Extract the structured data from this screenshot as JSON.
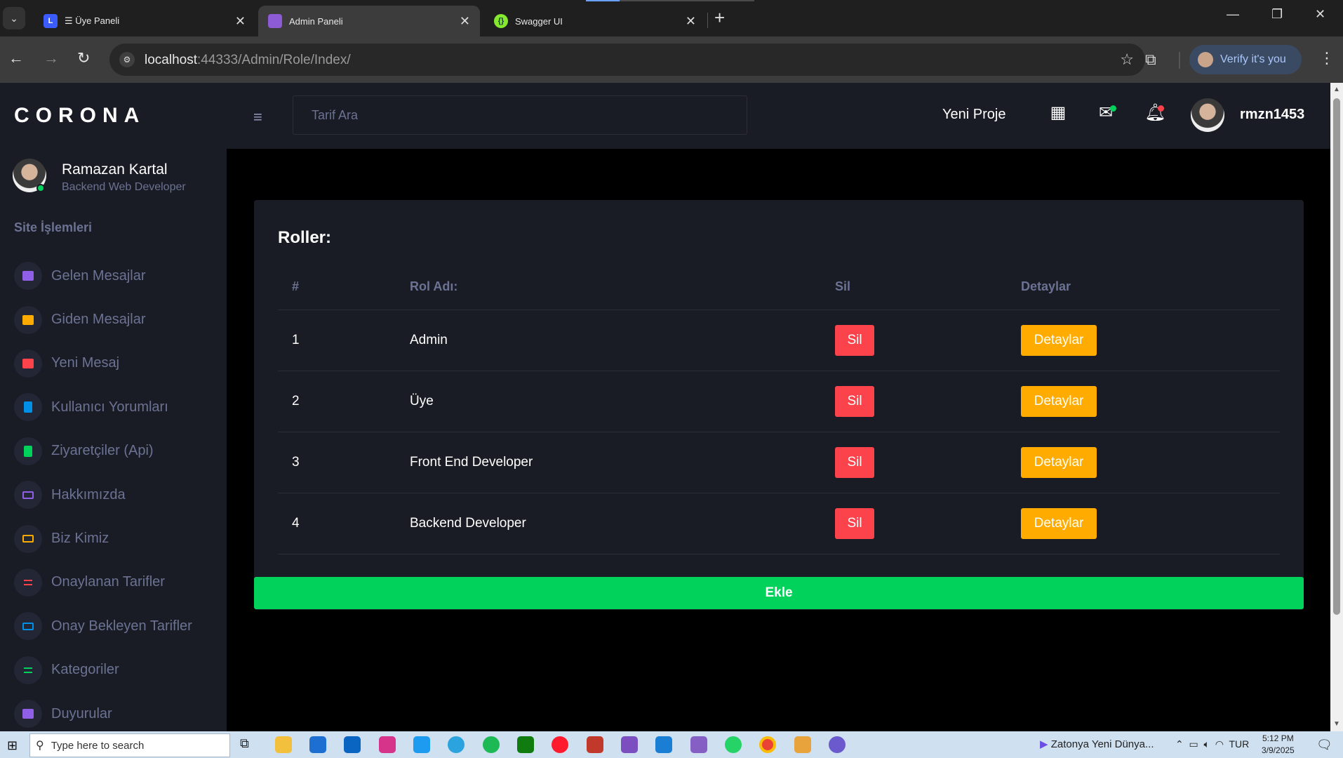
{
  "browser": {
    "tabs": [
      {
        "title": "☰ Üye Paneli",
        "favicon": "layout-icon",
        "color": "#3b5bfd",
        "active": false
      },
      {
        "title": "Admin Paneli",
        "favicon": "app-icon",
        "color": "#8e5bd6",
        "active": true
      },
      {
        "title": "Swagger UI",
        "favicon": "swagger-icon",
        "color": "#85ea2d",
        "active": false
      }
    ],
    "url_host": "localhost",
    "url_path": ":44333/Admin/Role/Index/",
    "verify_label": "Verify it's you"
  },
  "sidebar": {
    "brand": "CORONA",
    "profile_name": "Ramazan Kartal",
    "profile_role": "Backend Web Developer",
    "heading": "Site İşlemleri",
    "items": [
      {
        "label": "Gelen Mesajlar",
        "color": "#8f5fe8"
      },
      {
        "label": "Giden Mesajlar",
        "color": "#ffab00"
      },
      {
        "label": "Yeni Mesaj",
        "color": "#fc424a"
      },
      {
        "label": "Kullanıcı Yorumları",
        "color": "#0090e7"
      },
      {
        "label": "Ziyaretçiler (Api)",
        "color": "#00d25b"
      },
      {
        "label": "Hakkımızda",
        "color": "#8f5fe8"
      },
      {
        "label": "Biz Kimiz",
        "color": "#ffab00"
      },
      {
        "label": "Onaylanan Tarifler",
        "color": "#fc424a"
      },
      {
        "label": "Onay Bekleyen Tarifler",
        "color": "#0090e7"
      },
      {
        "label": "Kategoriler",
        "color": "#00d25b"
      },
      {
        "label": "Duyurular",
        "color": "#8f5fe8"
      }
    ]
  },
  "topnav": {
    "search_placeholder": "Tarif Ara",
    "new_project": "Yeni Proje",
    "username": "rmzn1453"
  },
  "roles": {
    "title": "Roller:",
    "headers": [
      "#",
      "Rol Adı:",
      "Sil",
      "Detaylar"
    ],
    "rows": [
      {
        "id": "1",
        "name": "Admin"
      },
      {
        "id": "2",
        "name": "Üye"
      },
      {
        "id": "3",
        "name": "Front End Developer"
      },
      {
        "id": "4",
        "name": "Backend Developer"
      }
    ],
    "delete_label": "Sil",
    "details_label": "Detaylar",
    "add_label": "Ekle"
  },
  "taskbar": {
    "search_placeholder": "Type here to search",
    "media_title": "Zatonya Yeni Dünya...",
    "lang": "TUR",
    "time": "5:12 PM",
    "date": "3/9/2025"
  }
}
